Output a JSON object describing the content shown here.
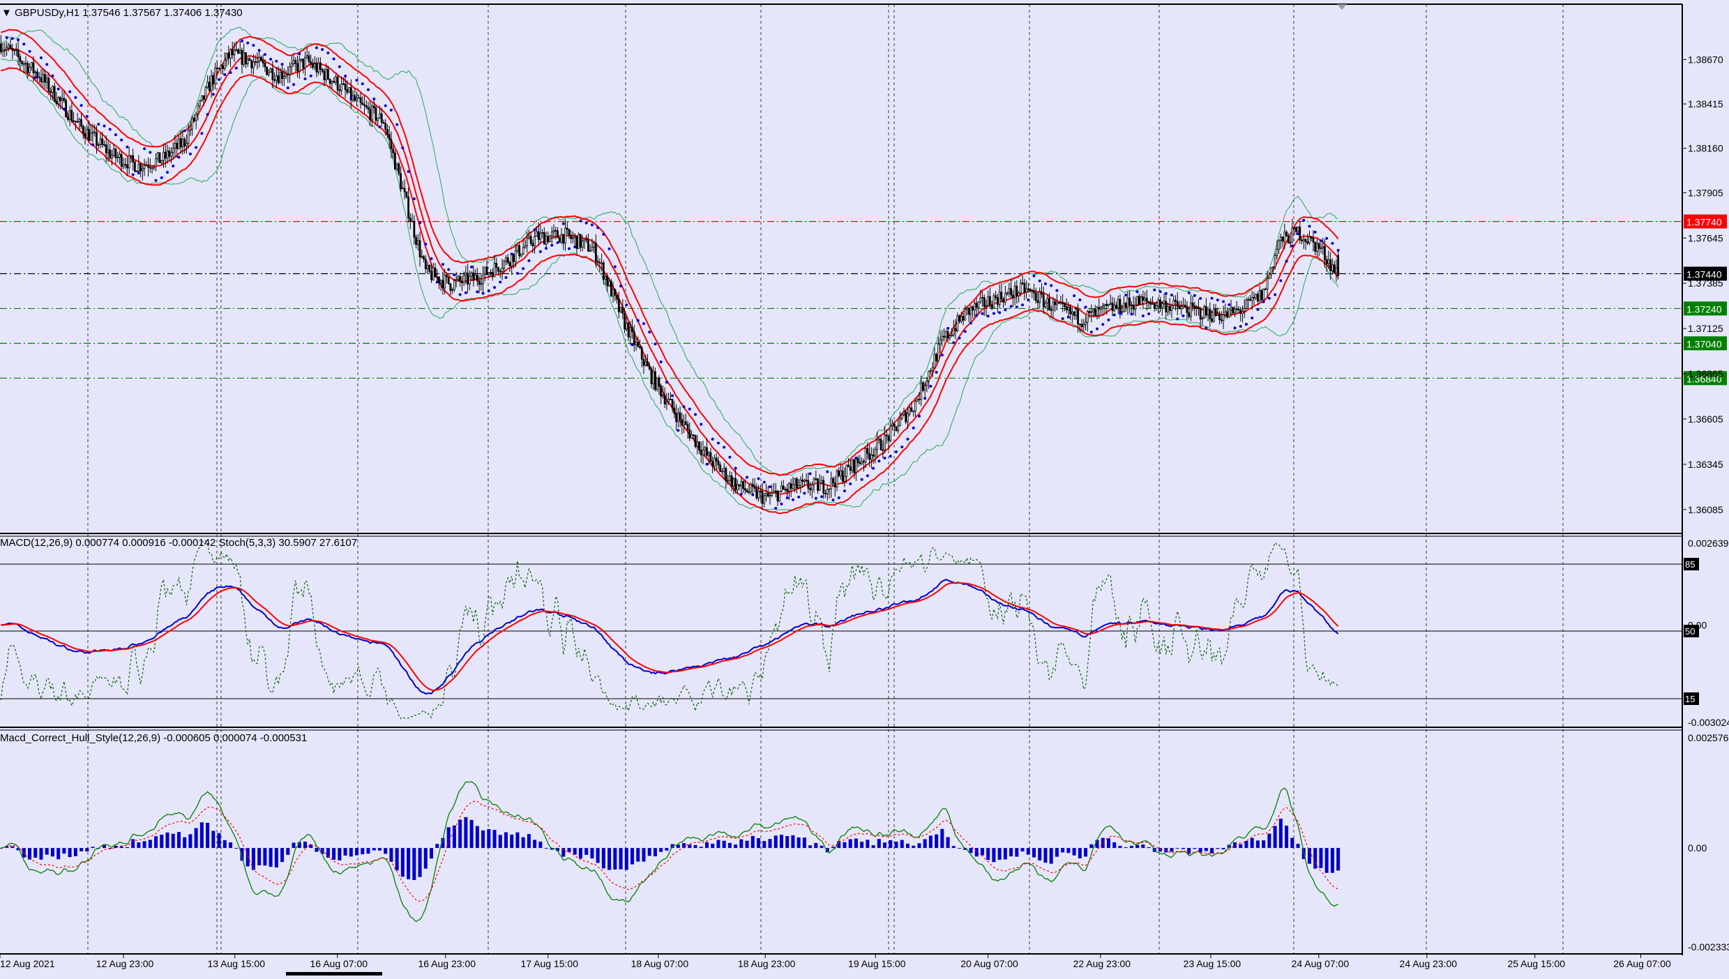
{
  "chart_data": [
    {
      "type": "candlestick",
      "panel": "main",
      "header": "▼ GBPUSDy,H1  1.37546 1.37567 1.37406 1.37430",
      "symbol": "GBPUSDy",
      "timeframe": "H1",
      "ohlc_last": {
        "open": 1.37546,
        "high": 1.37567,
        "low": 1.37406,
        "close": 1.3743
      },
      "ylim": [
        1.3596,
        1.3898
      ],
      "y_ticks": [
        "1.38670",
        "1.38415",
        "1.38160",
        "1.37905",
        "1.37645",
        "1.37385",
        "1.37125",
        "1.36865",
        "1.36605",
        "1.36345",
        "1.36085"
      ],
      "price_levels": [
        {
          "value": 1.3774,
          "label": "1.37740",
          "color": "#ff0000",
          "style": "dash-dot"
        },
        {
          "value": 1.3744,
          "label": "1.37440",
          "color": "#000000",
          "style": "dash-dot",
          "current": true
        },
        {
          "value": 1.3724,
          "label": "1.37240",
          "color": "#008000",
          "style": "dash-dot"
        },
        {
          "value": 1.3704,
          "label": "1.37040",
          "color": "#008000",
          "style": "dash-dot"
        },
        {
          "value": 1.3684,
          "label": "1.36840",
          "color": "#008000",
          "style": "dash-dot"
        }
      ],
      "x_labels": [
        "12 Aug 2021",
        "12 Aug 23:00",
        "13 Aug 15:00",
        "16 Aug 07:00",
        "16 Aug 23:00",
        "17 Aug 15:00",
        "18 Aug 07:00",
        "18 Aug 23:00",
        "19 Aug 15:00",
        "20 Aug 07:00",
        "22 Aug 23:00",
        "23 Aug 15:00",
        "24 Aug 07:00",
        "24 Aug 23:00",
        "25 Aug 15:00",
        "26 Aug 07:00"
      ],
      "close_path": [
        [
          0,
          1.3876
        ],
        [
          20,
          1.3858
        ],
        [
          40,
          1.383
        ],
        [
          58,
          1.3812
        ],
        [
          72,
          1.3806
        ],
        [
          85,
          1.381
        ],
        [
          96,
          1.382
        ],
        [
          110,
          1.3855
        ],
        [
          120,
          1.387
        ],
        [
          132,
          1.3866
        ],
        [
          145,
          1.3858
        ],
        [
          160,
          1.3866
        ],
        [
          175,
          1.3854
        ],
        [
          188,
          1.384
        ],
        [
          200,
          1.3832
        ],
        [
          212,
          1.3784
        ],
        [
          222,
          1.3745
        ],
        [
          235,
          1.3738
        ],
        [
          250,
          1.3742
        ],
        [
          265,
          1.3752
        ],
        [
          280,
          1.3765
        ],
        [
          295,
          1.3766
        ],
        [
          310,
          1.3758
        ],
        [
          325,
          1.3718
        ],
        [
          340,
          1.3685
        ],
        [
          355,
          1.366
        ],
        [
          370,
          1.3638
        ],
        [
          385,
          1.3622
        ],
        [
          400,
          1.3615
        ],
        [
          415,
          1.3622
        ],
        [
          432,
          1.3622
        ],
        [
          447,
          1.3635
        ],
        [
          462,
          1.3648
        ],
        [
          478,
          1.367
        ],
        [
          492,
          1.3705
        ],
        [
          505,
          1.3722
        ],
        [
          520,
          1.373
        ],
        [
          535,
          1.3735
        ],
        [
          550,
          1.3725
        ],
        [
          565,
          1.3718
        ],
        [
          580,
          1.3724
        ],
        [
          595,
          1.3728
        ],
        [
          610,
          1.3726
        ],
        [
          625,
          1.3722
        ],
        [
          640,
          1.372
        ],
        [
          650,
          1.3724
        ],
        [
          660,
          1.3733
        ],
        [
          668,
          1.3762
        ],
        [
          678,
          1.3768
        ],
        [
          690,
          1.3758
        ],
        [
          699,
          1.3743
        ]
      ],
      "series": [
        {
          "name": "",
          "role": "parabolic-sar",
          "color": "#0000cd"
        },
        {
          "name": "",
          "role": "envelope-bands",
          "color": "#ff0000"
        },
        {
          "name": "",
          "role": "bollinger-bands",
          "color": "#3cb371"
        }
      ]
    },
    {
      "type": "line",
      "panel": "macd-stochastic",
      "header": "MACD(12,26,9) 0.000774 0.000916 -0.000142  Stoch(5,3,3) 30.5907 27.6107",
      "y_ticks": [
        "0.002639",
        "0.00",
        "-0.003024"
      ],
      "levels": [
        "85",
        "50",
        "15"
      ],
      "series": [
        {
          "name": "",
          "role": "macd-main",
          "color": "#0000cd"
        },
        {
          "name": "",
          "role": "macd-signal",
          "color": "#ff0000"
        },
        {
          "name": "",
          "role": "stochastic",
          "color": "#006400",
          "style": "dotted"
        }
      ]
    },
    {
      "type": "bar",
      "panel": "macd-hull",
      "header": "Macd_Correct_Hull_Style(12,26,9) -0.000605 0.000074 -0.000531",
      "y_ticks": [
        "0.002576",
        "0.00",
        "-0.002333"
      ],
      "series": [
        {
          "name": "",
          "role": "histogram",
          "color": "#0000cd"
        },
        {
          "name": "",
          "role": "signal",
          "color": "#008000"
        },
        {
          "name": "",
          "role": "signal-dotted",
          "color": "#ff0000",
          "style": "dotted"
        }
      ]
    }
  ]
}
